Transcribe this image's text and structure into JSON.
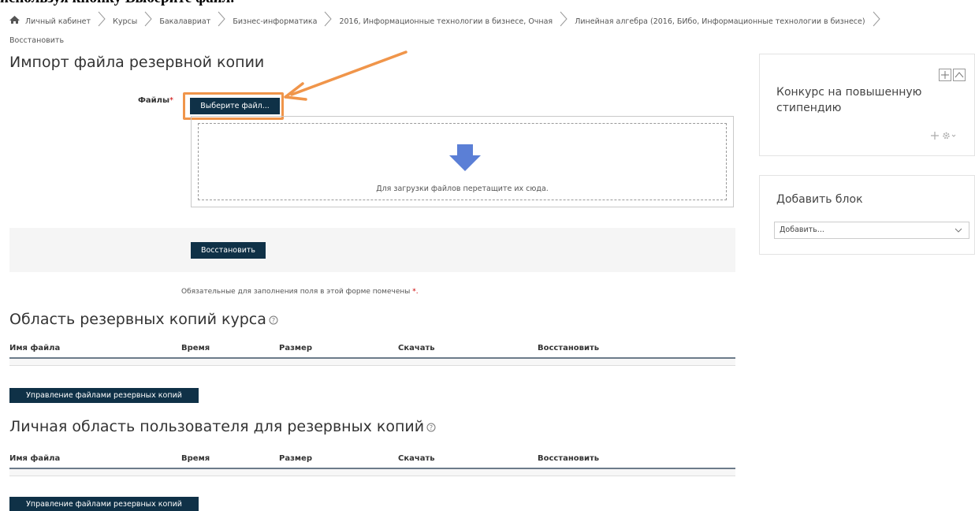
{
  "doc_fragment": "используя кнопку Выберите файл.",
  "breadcrumb": {
    "items": [
      "Личный кабинет",
      "Курсы",
      "Бакалавриат",
      "Бизнес-информатика",
      "2016, Информационные технологии в бизнесе, Очная",
      "Линейная алгебра (2016, БИбо, Информационные технологии в бизнесе)",
      "Восстановить"
    ]
  },
  "import": {
    "heading": "Импорт файла резервной копии",
    "files_label": "Файлы",
    "required_mark": "*",
    "choose_button": "Выберите файл...",
    "drop_text": "Для загрузки файлов перетащите их сюда.",
    "restore_button": "Восстановить",
    "required_note": "Обязательные для заполнения поля в этой форме помечены",
    "required_note_mark": "*."
  },
  "course_area": {
    "heading": "Область резервных копий курса",
    "columns": [
      "Имя файла",
      "Время",
      "Размер",
      "Скачать",
      "Восстановить"
    ],
    "manage_button": "Управление файлами резервных копий"
  },
  "user_area": {
    "heading": "Личная область пользователя для резервных копий",
    "columns": [
      "Имя файла",
      "Время",
      "Размер",
      "Скачать",
      "Восстановить"
    ],
    "manage_button": "Управление файлами резервных копий"
  },
  "blocks": {
    "contest": {
      "title": "Конкурс на повышенную стипендию"
    },
    "add_block": {
      "title": "Добавить блок",
      "select_value": "Добавить..."
    }
  },
  "colors": {
    "button_bg": "#0f3147",
    "highlight": "#f0954a",
    "required": "#cc0000"
  }
}
